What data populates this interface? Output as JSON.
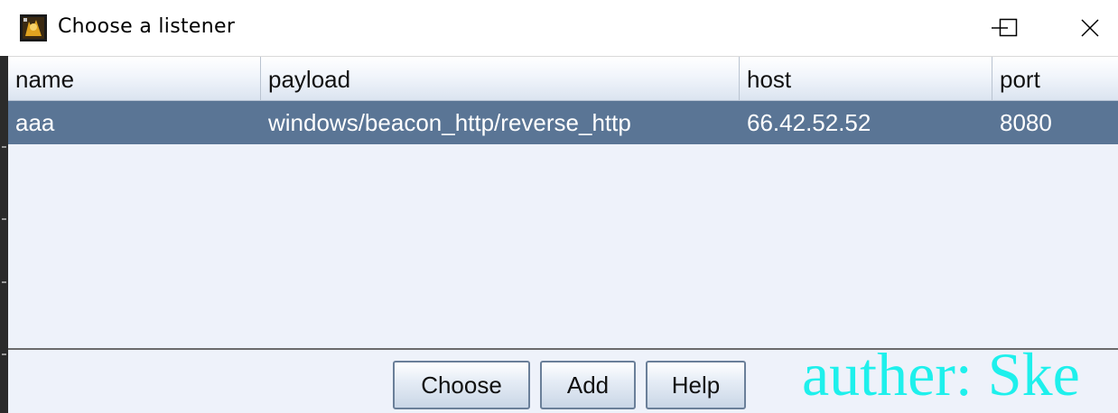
{
  "window": {
    "title": "Choose a listener",
    "icon": "cobalt-strike-app-icon",
    "controls": [
      "minimize-icon",
      "maximize-icon",
      "close-icon"
    ]
  },
  "table": {
    "columns": [
      "name",
      "payload",
      "host",
      "port"
    ],
    "rows": [
      {
        "name": "aaa",
        "payload": "windows/beacon_http/reverse_http",
        "host": "66.42.52.52",
        "port": "8080",
        "selected": true
      }
    ]
  },
  "buttons": {
    "choose": "Choose",
    "add": "Add",
    "help": "Help"
  },
  "watermark": "auther: Ske",
  "colors": {
    "selected_row": "#5a7595",
    "table_bg": "#eef2fa",
    "watermark": "#1ef0ec"
  }
}
